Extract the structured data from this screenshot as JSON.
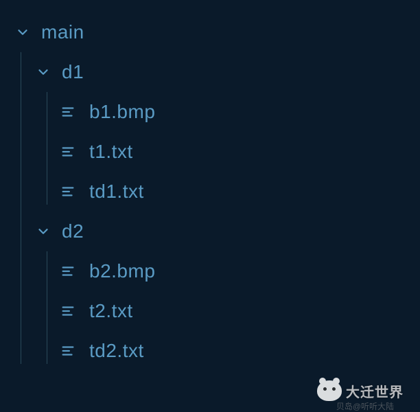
{
  "tree": {
    "root": {
      "name": "main",
      "children": [
        {
          "name": "d1",
          "children": [
            {
              "name": "b1.bmp"
            },
            {
              "name": "t1.txt"
            },
            {
              "name": "td1.txt"
            }
          ]
        },
        {
          "name": "d2",
          "children": [
            {
              "name": "b2.bmp"
            },
            {
              "name": "t2.txt"
            },
            {
              "name": "td2.txt"
            }
          ]
        }
      ]
    }
  },
  "watermark": {
    "text": "大迁世界",
    "sub": "贝岛@听听大陆"
  }
}
